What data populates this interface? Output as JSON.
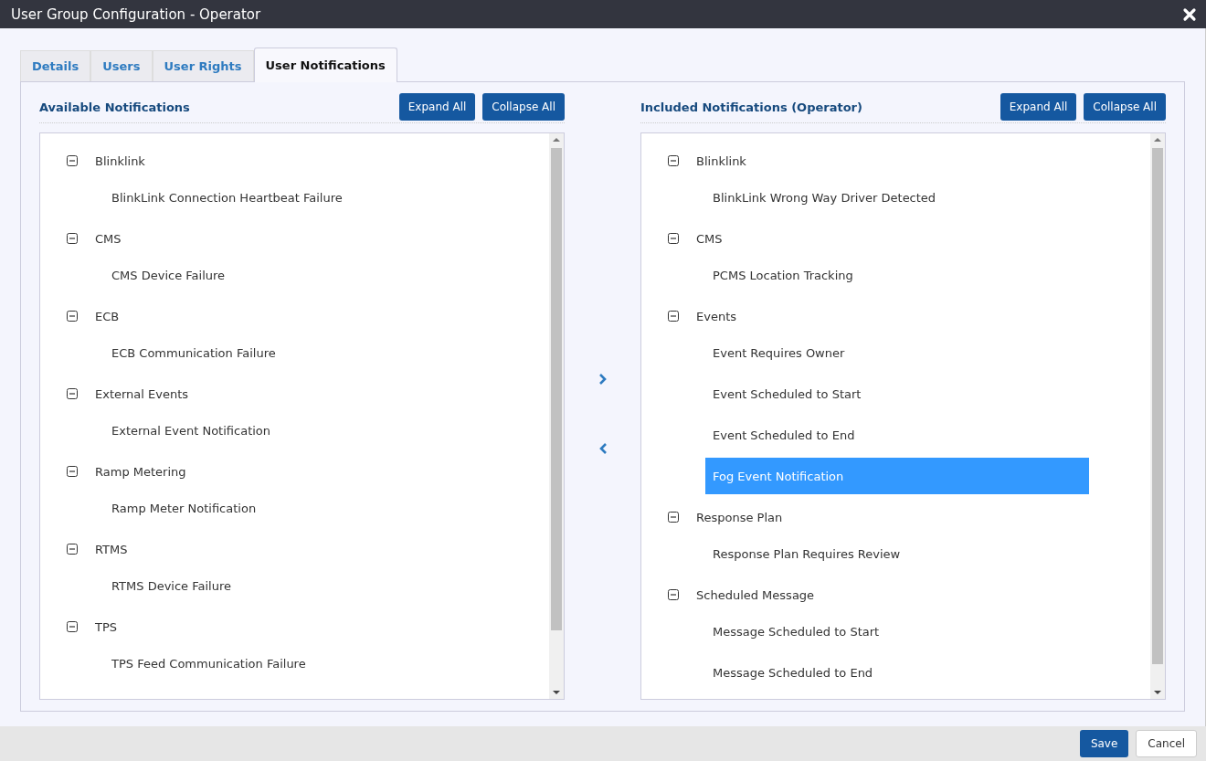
{
  "window": {
    "title": "User Group Configuration - Operator"
  },
  "tabs": [
    {
      "label": "Details",
      "selected": false
    },
    {
      "label": "Users",
      "selected": false
    },
    {
      "label": "User Rights",
      "selected": false
    },
    {
      "label": "User Notifications",
      "selected": true
    }
  ],
  "available": {
    "title": "Available Notifications",
    "buttons": [
      "Expand All",
      "Collapse All"
    ],
    "groups": [
      {
        "label": "Blinklink",
        "expanded": true,
        "children": [
          {
            "label": "BlinkLink Connection Heartbeat Failure",
            "selected": false
          }
        ]
      },
      {
        "label": "CMS",
        "expanded": true,
        "children": [
          {
            "label": "CMS Device Failure",
            "selected": false
          }
        ]
      },
      {
        "label": "ECB",
        "expanded": true,
        "children": [
          {
            "label": "ECB Communication Failure",
            "selected": false
          }
        ]
      },
      {
        "label": "External Events",
        "expanded": true,
        "children": [
          {
            "label": "External Event Notification",
            "selected": false
          }
        ]
      },
      {
        "label": "Ramp Metering",
        "expanded": true,
        "children": [
          {
            "label": "Ramp Meter Notification",
            "selected": false
          }
        ]
      },
      {
        "label": "RTMS",
        "expanded": true,
        "children": [
          {
            "label": "RTMS Device Failure",
            "selected": false
          }
        ]
      },
      {
        "label": "TPS",
        "expanded": true,
        "children": [
          {
            "label": "TPS Feed Communication Failure",
            "selected": false
          }
        ]
      }
    ]
  },
  "included": {
    "title": "Included Notifications (Operator)",
    "buttons": [
      "Expand All",
      "Collapse All"
    ],
    "groups": [
      {
        "label": "Blinklink",
        "expanded": true,
        "children": [
          {
            "label": "BlinkLink Wrong Way Driver Detected",
            "selected": false
          }
        ]
      },
      {
        "label": "CMS",
        "expanded": true,
        "children": [
          {
            "label": "PCMS Location Tracking",
            "selected": false
          }
        ]
      },
      {
        "label": "Events",
        "expanded": true,
        "children": [
          {
            "label": "Event Requires Owner",
            "selected": false
          },
          {
            "label": "Event Scheduled to Start",
            "selected": false
          },
          {
            "label": "Event Scheduled to End",
            "selected": false
          },
          {
            "label": "Fog Event Notification",
            "selected": true
          }
        ]
      },
      {
        "label": "Response Plan",
        "expanded": true,
        "children": [
          {
            "label": "Response Plan Requires Review",
            "selected": false
          }
        ]
      },
      {
        "label": "Scheduled Message",
        "expanded": true,
        "children": [
          {
            "label": "Message Scheduled to Start",
            "selected": false
          },
          {
            "label": "Message Scheduled to End",
            "selected": false
          }
        ]
      }
    ]
  },
  "footer": {
    "buttons": [
      {
        "label": "Save",
        "kind": "primary"
      },
      {
        "label": "Cancel",
        "kind": "secondary"
      }
    ]
  }
}
